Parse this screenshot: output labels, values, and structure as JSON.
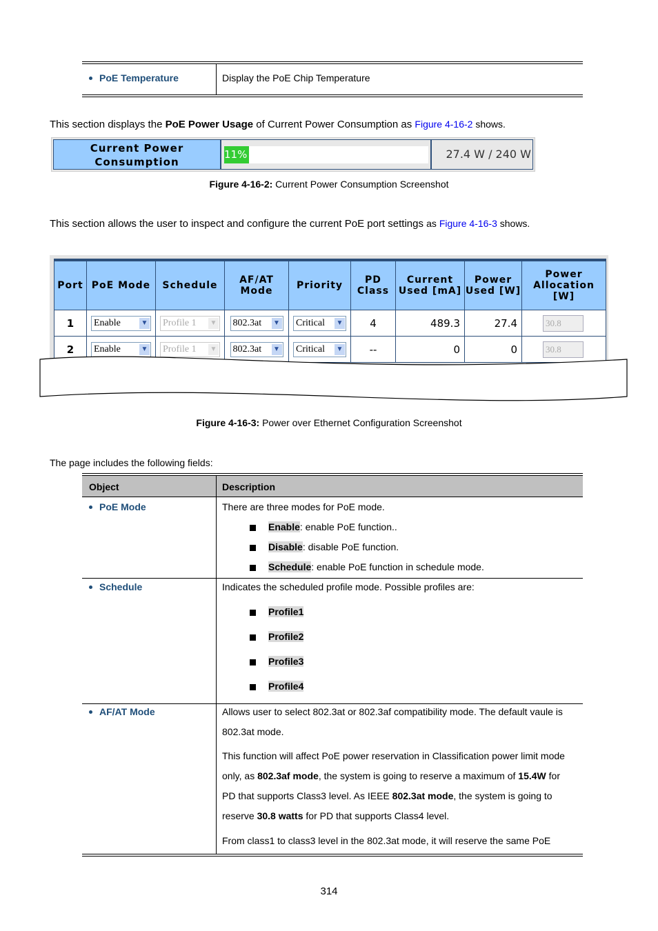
{
  "top_table": {
    "object": "PoE Temperature",
    "description": "Display the PoE Chip Temperature"
  },
  "para1": {
    "pre": "This section displays the ",
    "bold": "PoE Power Usage",
    "mid": " of Current Power Consumption as ",
    "link": "Figure 4-16-2",
    "post": " shows."
  },
  "power": {
    "label": "Current Power Consumption",
    "percent": 11,
    "percent_label": "11%",
    "value": "27.4 W / 240 W",
    "bar_color": "#33cc33",
    "header_color": "#99ccff"
  },
  "caption1": {
    "bold": "Figure 4-16-2:",
    "text": " Current Power Consumption Screenshot"
  },
  "para2": {
    "pre": "This section allows the user to inspect and configure the current PoE port settings ",
    "small": "as ",
    "link": "Figure 4-16-3",
    "post": " shows."
  },
  "config": {
    "headers": [
      "Port",
      "PoE Mode",
      "Schedule",
      "AF/AT Mode",
      "Priority",
      "PD Class",
      "Current Used [mA]",
      "Power Used [W]",
      "Power Allocation [W]"
    ],
    "rows": [
      {
        "port": "1",
        "poe_mode": "Enable",
        "schedule": "Profile 1",
        "afat": "802.3at",
        "priority": "Critical",
        "pd_class": "4",
        "current": "489.3",
        "power": "27.4",
        "allocation": "30.8"
      },
      {
        "port": "2",
        "poe_mode": "Enable",
        "schedule": "Profile 1",
        "afat": "802.3at",
        "priority": "Critical",
        "pd_class": "--",
        "current": "0",
        "power": "0",
        "allocation": "30.8"
      }
    ]
  },
  "caption2": {
    "bold": "Figure 4-16-3:",
    "text": " Power over Ethernet Configuration Screenshot"
  },
  "para3": "The page includes the following fields:",
  "fields": {
    "header_object": "Object",
    "header_description": "Description",
    "poe_mode": {
      "name": "PoE Mode",
      "intro": "There are three modes for PoE mode.",
      "items": [
        {
          "k": "Enable",
          "v": ": enable PoE function.."
        },
        {
          "k": "Disable",
          "v": ": disable PoE function."
        },
        {
          "k": "Schedule",
          "v": ": enable PoE function in schedule mode."
        }
      ]
    },
    "schedule": {
      "name": "Schedule",
      "intro": "Indicates the scheduled profile mode. Possible profiles are:",
      "items": [
        "Profile1",
        "Profile2",
        "Profile3",
        "Profile4"
      ]
    },
    "afat": {
      "name": "AF/AT Mode",
      "l1": "Allows user to select 802.3at or 802.3af compatibility mode. The default vaule is",
      "l2": "802.3at mode.",
      "l3": "This function will affect PoE power reservation in Classification power limit mode",
      "l4a": "only, as ",
      "l4b": "802.3af mode",
      "l4c": ", the system is going to reserve a maximum of ",
      "l4d": "15.4W",
      "l4e": " for",
      "l5a": "PD that supports Class3 level. As IEEE ",
      "l5b": "802.3at mode",
      "l5c": ", the system is going to",
      "l6a": "reserve ",
      "l6b": "30.8 watts",
      "l6c": " for PD that supports Class4 level.",
      "l7": "From class1 to class3 level in the 802.3at mode, it will reserve the same PoE"
    }
  },
  "page_number": "314"
}
